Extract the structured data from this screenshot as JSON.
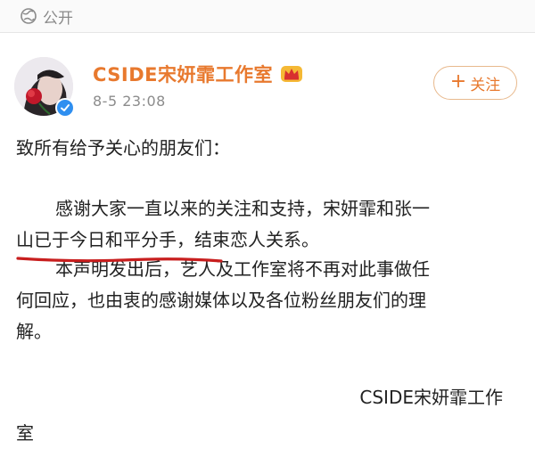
{
  "visibility": {
    "icon": "globe-icon",
    "label": "公开"
  },
  "post": {
    "author": "CSIDE宋妍霏工作室",
    "time": "8-5 23:08",
    "follow_label": "关注",
    "crown_icon": "crown-badge-icon",
    "verified_icon": "verified-icon"
  },
  "body": {
    "greeting": "致所有给予关心的朋友们：",
    "line1": "感谢大家一直以来的关注和支持，宋妍霏和张一",
    "line2": "山已于今日和平分手，结束恋人关系。",
    "line3": "本声明发出后，艺人及工作室将不再对此事做任",
    "line4": "何回应，也由衷的感谢媒体以及各位粉丝朋友们的理",
    "line5": "解。",
    "signature1": "CSIDE宋妍霏工作",
    "signature2": "室"
  },
  "colors": {
    "accent": "#e8792e",
    "verified": "#2f8ff0",
    "underline": "#c81e1e"
  }
}
